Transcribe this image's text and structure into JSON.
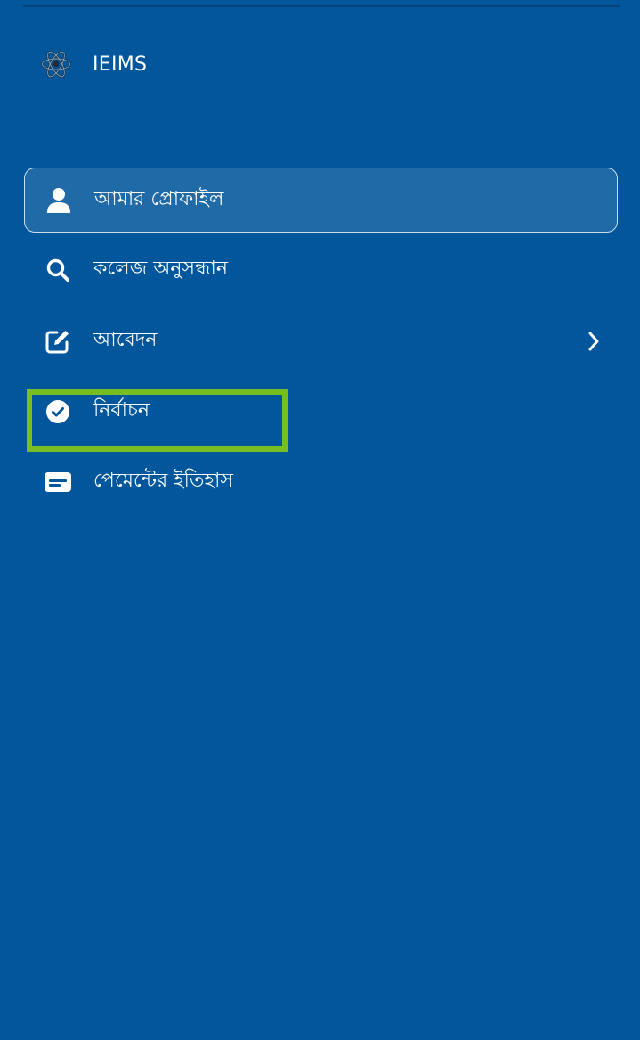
{
  "app": {
    "title": "IEIMS",
    "logo_icon": "react-atom-icon"
  },
  "nav": {
    "items": [
      {
        "label": "আমার প্রোফাইল",
        "icon": "user-icon",
        "active": true,
        "has_submenu": false
      },
      {
        "label": "কলেজ অনুসন্ধান",
        "icon": "search-icon",
        "active": false,
        "has_submenu": false
      },
      {
        "label": "আবেদন",
        "icon": "edit-icon",
        "active": false,
        "has_submenu": true
      },
      {
        "label": "নির্বাচন",
        "icon": "check-circle-icon",
        "active": false,
        "has_submenu": false,
        "highlighted": true
      },
      {
        "label": "পেমেন্টের ইতিহাস",
        "icon": "id-card-icon",
        "active": false,
        "has_submenu": false
      }
    ]
  },
  "colors": {
    "background": "#02569b",
    "active_item_border": "#ffffff",
    "highlight_box": "#78be20",
    "text": "#ffffff"
  }
}
